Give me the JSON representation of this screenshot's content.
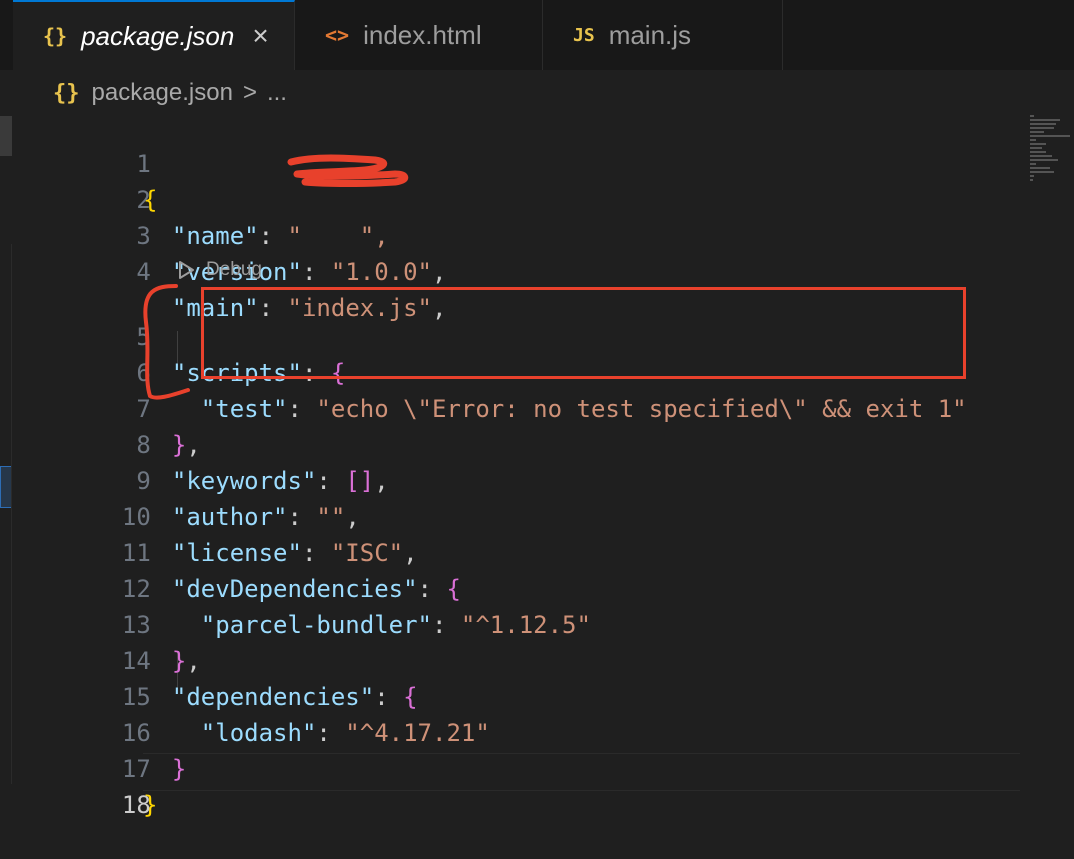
{
  "tabs": [
    {
      "icon": "{}",
      "label": "package.json",
      "active": true,
      "close": "×",
      "icon_color": "#e8c34e"
    },
    {
      "icon": "<>",
      "label": "index.html",
      "active": false,
      "icon_color": "#e37933"
    },
    {
      "icon": "JS",
      "label": "main.js",
      "active": false,
      "icon_color": "#e8c34e"
    }
  ],
  "breadcrumb": {
    "icon": "{}",
    "file": "package.json",
    "sep": ">",
    "more": "..."
  },
  "codelens": {
    "icon": "play-icon",
    "label": "Debug"
  },
  "line_numbers": [
    "1",
    "2",
    "3",
    "4",
    "5",
    "6",
    "7",
    "8",
    "9",
    "10",
    "11",
    "12",
    "13",
    "14",
    "15",
    "16",
    "17",
    "18"
  ],
  "code": {
    "l1": "{",
    "l2_key": "\"name\"",
    "l2_val": "\"",
    "l2_end": "\",",
    "l3_key": "\"version\"",
    "l3_val": "\"1.0.0\"",
    "l4_key": "\"main\"",
    "l4_val": "\"index.js\"",
    "l5_key": "\"scripts\"",
    "l5_brace": "{",
    "l6_key": "\"test\"",
    "l6_val": "\"echo \\\"Error: no test specified\\\" && exit 1\"",
    "l7_brace": "}",
    "l8_key": "\"keywords\"",
    "l8_val": "[]",
    "l9_key": "\"author\"",
    "l9_val": "\"\"",
    "l10_key": "\"license\"",
    "l10_val": "\"ISC\"",
    "l11_key": "\"devDependencies\"",
    "l11_brace": "{",
    "l12_key": "\"parcel-bundler\"",
    "l12_val": "\"^1.12.5\"",
    "l13_brace": "}",
    "l14_key": "\"dependencies\"",
    "l14_brace": "{",
    "l15_key": "\"lodash\"",
    "l15_val": "\"^4.17.21\"",
    "l16_brace": "}",
    "l17": "}"
  },
  "colors": {
    "accent": "#0078d4",
    "annotation": "#e8412c"
  }
}
